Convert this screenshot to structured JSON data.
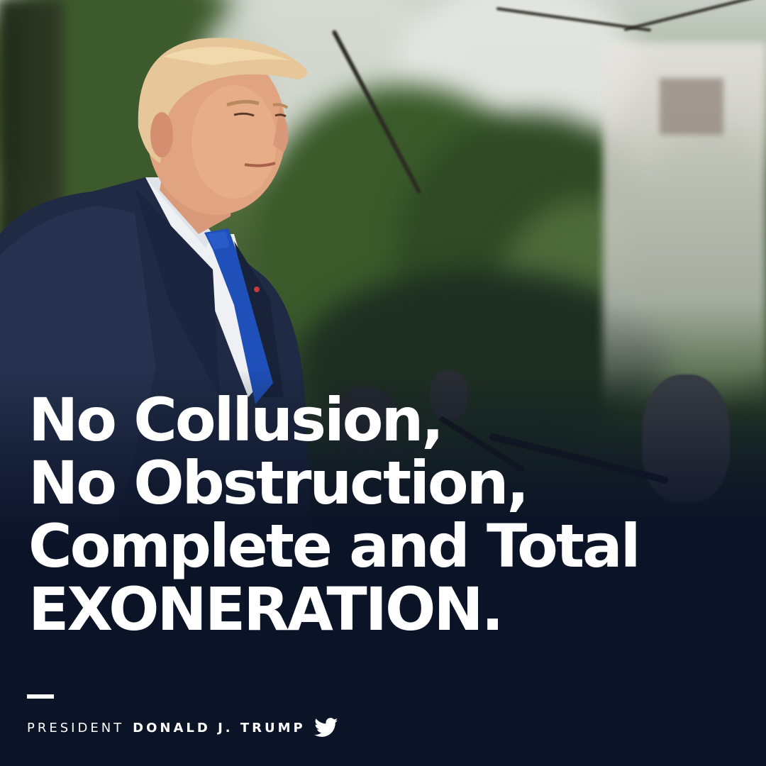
{
  "headline": {
    "line1": "No Collusion,",
    "line2": "No Obstruction,",
    "line3": "Complete and Total",
    "line4": "EXONERATION."
  },
  "byline": {
    "prefix": "PRESIDENT",
    "name": "DONALD J. TRUMP",
    "icon": "twitter-bird-icon"
  },
  "colors": {
    "background": "#0b1327",
    "text": "#ffffff",
    "suit": "#1f2b45",
    "tie": "#1f4fb8"
  }
}
